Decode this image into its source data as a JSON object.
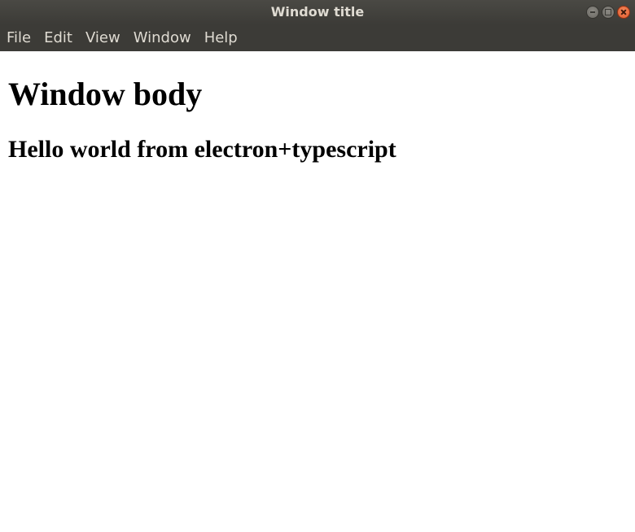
{
  "window": {
    "title": "Window title"
  },
  "menubar": {
    "items": [
      {
        "label": "File"
      },
      {
        "label": "Edit"
      },
      {
        "label": "View"
      },
      {
        "label": "Window"
      },
      {
        "label": "Help"
      }
    ]
  },
  "content": {
    "heading": "Window body",
    "subheading": "Hello world from electron+typescript"
  },
  "colors": {
    "titlebar_bg": "#3c3b37",
    "titlebar_text": "#dfdbd2",
    "close_button": "#e05a2b",
    "body_bg": "#ffffff"
  },
  "icons": {
    "minimize": "minimize-icon",
    "maximize": "maximize-icon",
    "close": "close-icon"
  }
}
